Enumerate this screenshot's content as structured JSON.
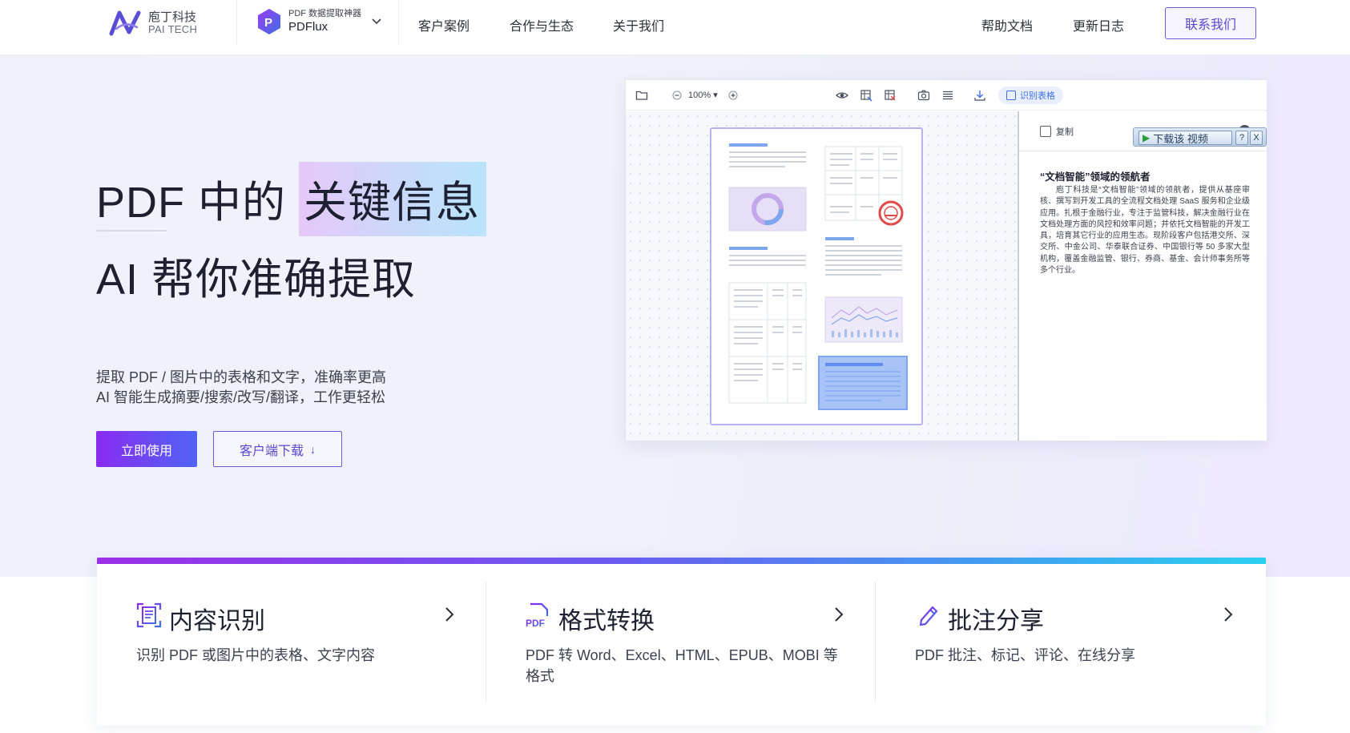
{
  "nav": {
    "logo_cn": "庖丁科技",
    "logo_en": "PAI TECH",
    "product_tag": "PDF 数据提取神器",
    "product_name": "PDFlux",
    "links": [
      "客户案例",
      "合作与生态",
      "关于我们"
    ],
    "right_links": [
      "帮助文档",
      "更新日志"
    ],
    "contact_label": "联系我们"
  },
  "hero": {
    "title_prefix": "PDF 中的",
    "title_highlight": "关键信息",
    "title_line2": "AI 帮你准确提取",
    "subtitle_line1": "提取 PDF / 图片中的表格和文字，准确率更高",
    "subtitle_line2": "AI 智能生成摘要/搜索/改写/翻译，工作更轻松",
    "primary_button": "立即使用",
    "download_button": "客户端下载",
    "download_arrow": "↓"
  },
  "app": {
    "zoom": "100%",
    "recognize_table": "识别表格",
    "copy_label": "复制",
    "close_glyph": "×",
    "side_title": "“文档智能”领域的领航者",
    "side_body": "庖丁科技是“文档智能”领域的领航者，提供从基座审核、撰写到开发工具的全流程文档处理 SaaS 服务和企业级应用。扎根于金融行业，专注于监管科技，解决金融行业在文档处理方面的风控和效率问题；并依托文档智能的开发工具，培育其它行业的应用生态。现阶段客户包括港交所、深交所、中金公司、华泰联合证券、中国银行等 50 多家大型机构，覆盖金融监管、银行、券商、基金、会计师事务所等多个行业。"
  },
  "video_overlay": {
    "label": "下载该 视频",
    "help": "?",
    "close": "X"
  },
  "features": [
    {
      "title": "内容识别",
      "desc": "识别 PDF 或图片中的表格、文字内容",
      "icon": "document-scan-icon"
    },
    {
      "title": "格式转换",
      "desc": "PDF 转 Word、Excel、HTML、EPUB、MOBI 等格式",
      "icon": "pdf-file-icon"
    },
    {
      "title": "批注分享",
      "desc": "PDF 批注、标记、评论、在线分享",
      "icon": "pen-annotate-icon"
    }
  ],
  "colors": {
    "brand_purple": "#5a49cf",
    "primary_gradient_start": "#8a2bf0",
    "primary_gradient_end": "#4f64f5",
    "accent_blue": "#3f6fe6"
  }
}
